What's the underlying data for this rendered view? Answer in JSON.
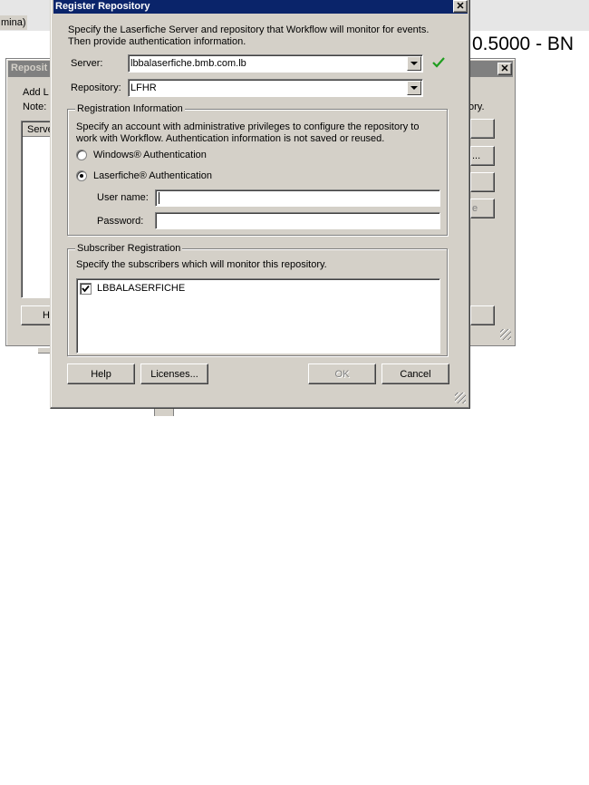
{
  "background": {
    "top_left_text": "mina)",
    "title_fragment": "0.5000 - BN"
  },
  "repo_window": {
    "title": "Reposit",
    "label_add": "Add L",
    "label_note": "Note:",
    "column_header": "Serve",
    "button_help_fragment": "H",
    "right_text_fragment": "ory.",
    "right_btn2_fragment": "...",
    "right_btn4_fragment": "e"
  },
  "dialog": {
    "title": "Register Repository",
    "intro": "Specify the Laserfiche Server and repository that Workflow will monitor for events. Then provide authentication information.",
    "server_label": "Server:",
    "server_value": "lbbalaserfiche.bmb.com.lb",
    "repository_label": "Repository:",
    "repository_value": "LFHR",
    "reg_group_title": "Registration Information",
    "reg_desc": "Specify an account with administrative privileges to configure the repository to work with Workflow. Authentication information is not saved or reused.",
    "windows_auth": "Windows® Authentication",
    "laserfiche_auth": "Laserfiche® Authentication",
    "username_label": "User name:",
    "username_value": "",
    "password_label": "Password:",
    "password_value": "",
    "sub_group_title": "Subscriber Registration",
    "sub_desc": "Specify the subscribers which will monitor this repository.",
    "subscribers": [
      "LBBALASERFICHE"
    ],
    "btn_help": "Help",
    "btn_licenses": "Licenses...",
    "btn_ok": "OK",
    "btn_cancel": "Cancel"
  },
  "colors": {
    "dialog_face": "#d4d0c8",
    "titlebar_active": "#0a246a",
    "titlebar_inactive": "#808080",
    "ok_check": "#1f9e1f"
  }
}
